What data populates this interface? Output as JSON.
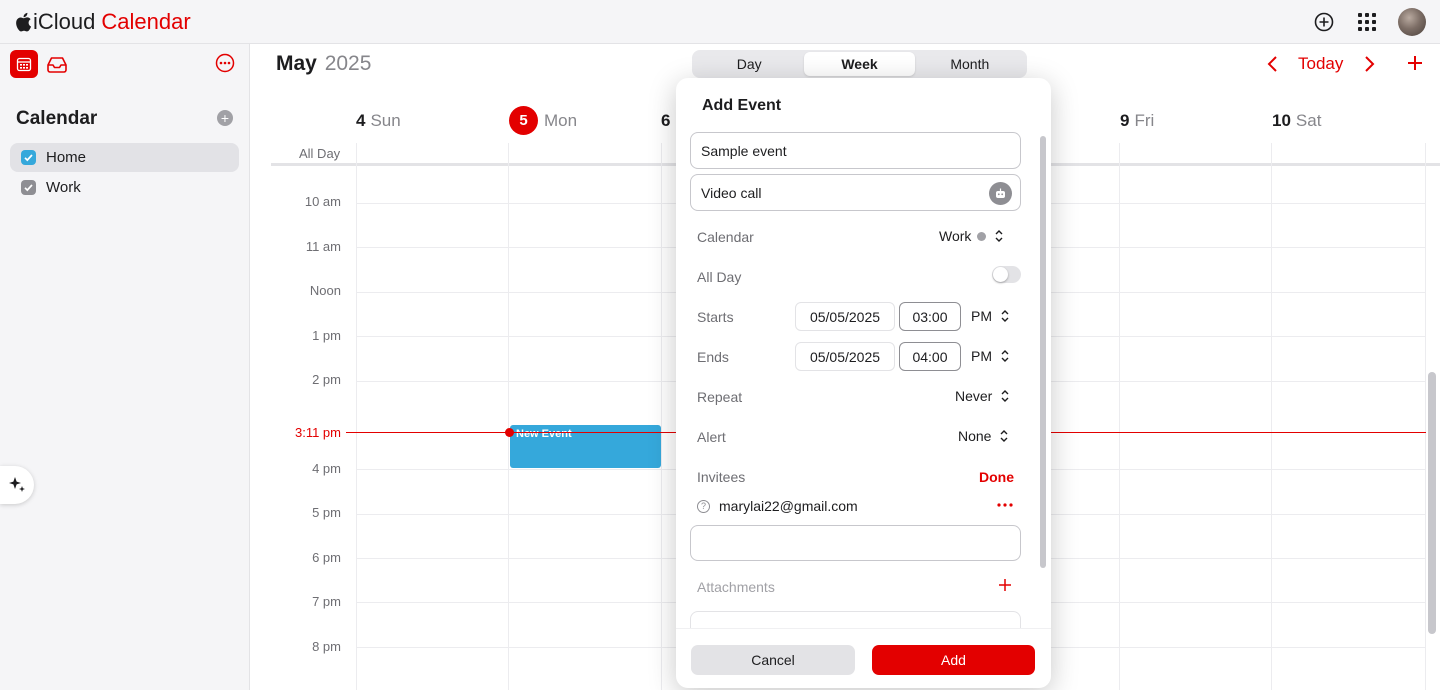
{
  "app": {
    "brand": "iCloud",
    "name": "Calendar"
  },
  "colors": {
    "accent": "#e30000",
    "home_calendar": "#35a8db",
    "work_calendar": "#8e8e93",
    "event_block": "#35a8db"
  },
  "topbar": {
    "icons": [
      "add-circle-icon",
      "apps-grid-icon",
      "avatar"
    ]
  },
  "sidebar": {
    "icons": [
      "calendar-icon",
      "inbox-icon",
      "more-icon"
    ],
    "title": "Calendar",
    "calendars": [
      {
        "label": "Home",
        "checked": true,
        "color": "#35a8db"
      },
      {
        "label": "Work",
        "checked": true,
        "color": "#8e8e93"
      }
    ]
  },
  "header": {
    "month": "May",
    "year": "2025",
    "views": [
      "Day",
      "Week",
      "Month"
    ],
    "selected_view": "Week",
    "today_label": "Today"
  },
  "week": {
    "days": [
      {
        "num": "4",
        "name": "Sun"
      },
      {
        "num": "5",
        "name": "Mon",
        "today": true
      },
      {
        "num": "6",
        "name": ""
      },
      {
        "num": "9",
        "name": "Fri"
      },
      {
        "num": "10",
        "name": "Sat"
      }
    ],
    "all_day_label": "All Day",
    "hours": [
      "10 am",
      "11 am",
      "Noon",
      "1 pm",
      "2 pm",
      "4 pm",
      "5 pm",
      "6 pm",
      "7 pm",
      "8 pm"
    ],
    "current_time": "3:11 pm",
    "event_title": "New Event"
  },
  "popover": {
    "title": "Add Event",
    "title_value": "Sample event",
    "location_value": "Video call",
    "calendar_label": "Calendar",
    "calendar_value": "Work",
    "allday_label": "All Day",
    "allday_on": false,
    "starts_label": "Starts",
    "start_date": "05/05/2025",
    "start_time": "03:00",
    "start_period": "PM",
    "ends_label": "Ends",
    "end_date": "05/05/2025",
    "end_time": "04:00",
    "end_period": "PM",
    "repeat_label": "Repeat",
    "repeat_value": "Never",
    "alert_label": "Alert",
    "alert_value": "None",
    "invitees_label": "Invitees",
    "done_label": "Done",
    "invitee_email": "marylai22@gmail.com",
    "invitee_input_value": "",
    "attachments_label": "Attachments",
    "cancel_label": "Cancel",
    "add_label": "Add"
  }
}
